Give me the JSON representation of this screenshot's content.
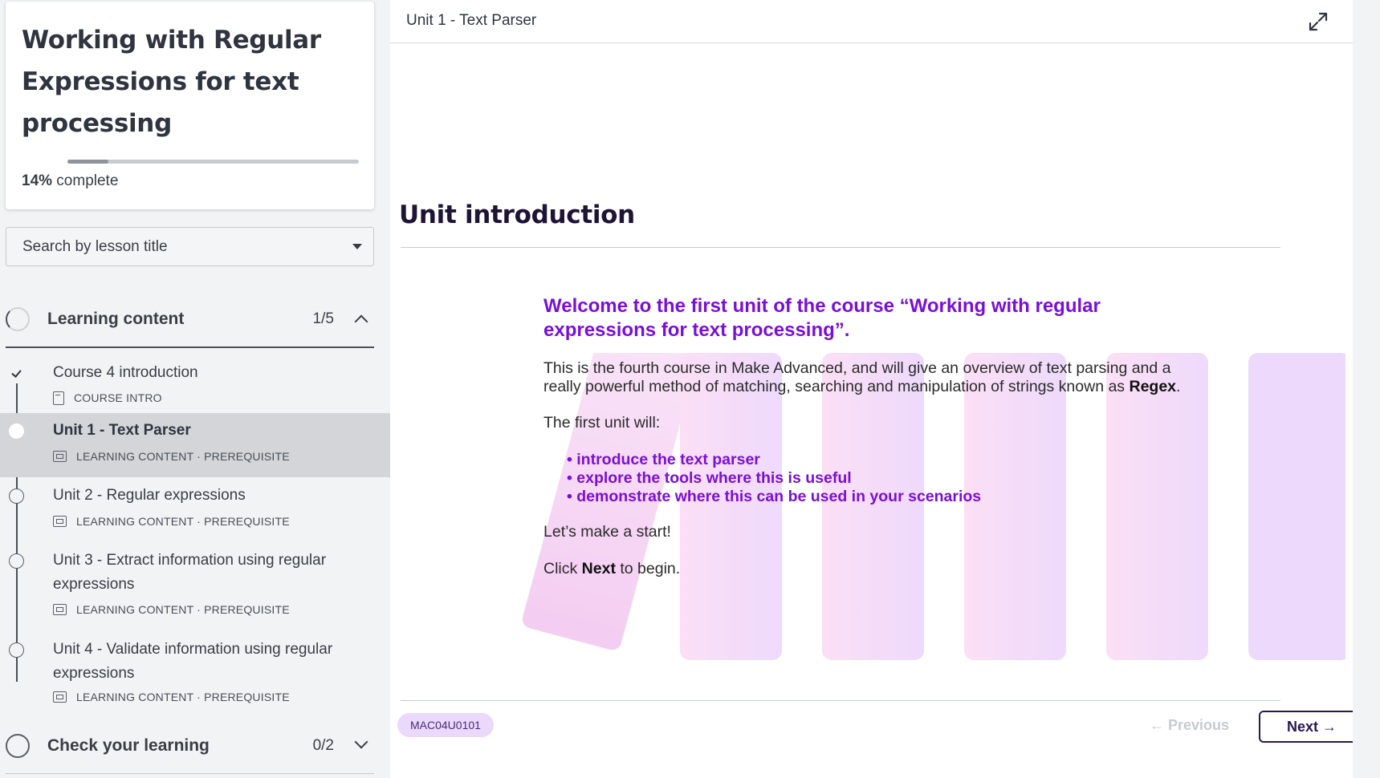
{
  "course": {
    "title": "Working with Regular Expressions for text processing",
    "progress_percent": "14%",
    "progress_label": " complete",
    "progress_fraction": 0.14
  },
  "search": {
    "placeholder": "Search by lesson title"
  },
  "sections": [
    {
      "title": "Learning content",
      "count": "1/5",
      "expanded": true,
      "lessons": [
        {
          "title": "Course 4 introduction",
          "meta": "COURSE INTRO",
          "status": "completed"
        },
        {
          "title": "Unit 1 - Text Parser",
          "meta": "LEARNING CONTENT · PREREQUISITE",
          "status": "active"
        },
        {
          "title": "Unit 2 - Regular expressions",
          "meta": "LEARNING CONTENT · PREREQUISITE",
          "status": "not-started"
        },
        {
          "title": "Unit 3 - Extract information using regular expressions",
          "meta": "LEARNING CONTENT · PREREQUISITE",
          "status": "not-started"
        },
        {
          "title": "Unit 4 - Validate information using regular expressions",
          "meta": "LEARNING CONTENT · PREREQUISITE",
          "status": "not-started"
        }
      ]
    },
    {
      "title": "Check your learning",
      "count": "0/2",
      "expanded": false
    }
  ],
  "main": {
    "header_title": "Unit 1 - Text Parser",
    "heading": "Unit introduction",
    "lead": "Welcome to the first unit of the course “Working with regular expressions for text processing”.",
    "para1_a": "This is the fourth course in Make Advanced, and will give an overview of text parsing and a really powerful method of matching, searching and manipulation of strings known as ",
    "para1_b": "Regex",
    "para1_c": ".",
    "para2": "The first unit will:",
    "bullets": [
      "introduce the text parser",
      "explore the tools where this is useful",
      "demonstrate where this can be used in your scenarios"
    ],
    "para3": "Let’s make a start!",
    "para4_a": "Click ",
    "para4_b": "Next",
    "para4_c": " to begin.",
    "unit_code": "MAC04U0101",
    "prev_label": "← Previous",
    "next_label": "Next →"
  },
  "colors": {
    "accent_purple": "#7a0fd6",
    "heading_dark": "#1f1436",
    "next_button_border": "#2a1654",
    "unit_code_bg": "#ead9fb",
    "art_pink": "#f7d9f5",
    "art_violet": "#ecd6fb"
  },
  "icons": {
    "expand": "expand-arrows-icon",
    "search_dropdown": "caret-down-icon",
    "section_expanded": "chevron-up-icon",
    "section_collapsed": "chevron-down-icon",
    "lesson_doc": "document-icon",
    "lesson_slides": "slides-icon",
    "completed": "checkmark-icon"
  }
}
